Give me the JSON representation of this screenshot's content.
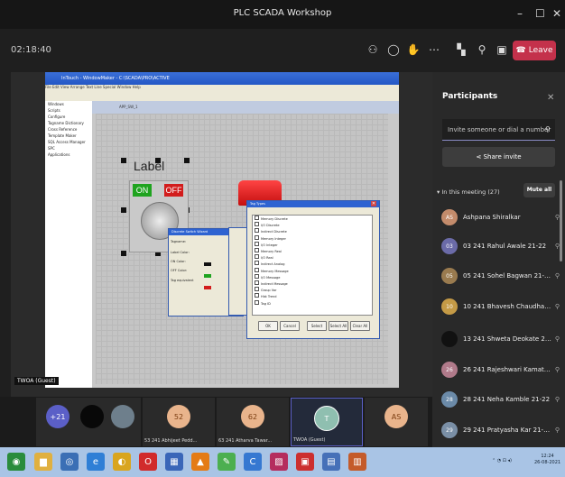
{
  "window": {
    "title": "PLC SCADA Workshop",
    "minimize": "–",
    "maximize": "☐",
    "close": "✕"
  },
  "meeting": {
    "timer": "02:18:40",
    "leave_label": "Leave",
    "icons": [
      "participants-icon",
      "chat-icon",
      "reactions-icon",
      "more-icon",
      "camera-off-icon",
      "mic-off-icon",
      "share-tray-icon"
    ]
  },
  "shared_screen": {
    "app_title": "InTouch - WindowMaker - C:\\SCADA\\PRO\\ACTIVE",
    "menu_text": "File  Edit  View  Arrange  Text  Line  Special  Window  Help",
    "tree_items": [
      "Windows",
      "Scripts",
      "Configure",
      "Tagname Dictionary",
      "Cross Reference",
      "Template Maker",
      "SQL Access Manager",
      "SPC",
      "Applications"
    ],
    "canvas_tab": "APP_SW_1",
    "switch_label": "Label",
    "on_label": "ON",
    "off_label": "OFF",
    "dialog1_title": "Discrete Switch Wizard",
    "dialog1_tagname_label": "Tagname:",
    "dialog1_fields": [
      "Label Color:",
      "ON Color:",
      "OFF Color:",
      "Switch Label:",
      "ON Label:",
      "OFF Label:"
    ],
    "dialog1_button": "Tag equivalent",
    "dialog3_title": "Tag Types",
    "tag_types": [
      "Memory Discrete",
      "I/O Discrete",
      "Indirect Discrete",
      "Memory Integer",
      "I/O Integer",
      "Memory Real",
      "I/O Real",
      "Indirect Analog",
      "Memory Message",
      "I/O Message",
      "Indirect Message",
      "Group Var",
      "Hist Trend",
      "Tag ID"
    ],
    "dialog_buttons": [
      "OK",
      "Cancel",
      "Select",
      "Select All",
      "Clear All"
    ],
    "speaker_tag": "TWOA (Guest)"
  },
  "participants_panel": {
    "title": "Participants",
    "invite_placeholder": "Invite someone or dial a number",
    "share_invite": "Share invite",
    "section_label": "In this meeting (27)",
    "mute_all": "Mute all",
    "people": [
      {
        "initials": "AS",
        "name": "Ashpana Shiralkar",
        "color": "#c38b6b"
      },
      {
        "initials": "03",
        "name": "03 241 Rahul Awale 21-22",
        "color": "#6b6ba8"
      },
      {
        "initials": "05",
        "name": "05 241 Sohel Bagwan 21-22",
        "color": "#9a7b4f"
      },
      {
        "initials": "10",
        "name": "10 241 Bhavesh Chaudhari 21...",
        "color": "#c49a46"
      },
      {
        "initials": "",
        "name": "13 241 Shweta Deokate 21-22",
        "color": "#111111"
      },
      {
        "initials": "26",
        "name": "26 241 Rajeshwari Kamat 21-22",
        "color": "#b07a8a"
      },
      {
        "initials": "28",
        "name": "28 241 Neha Kamble 21-22",
        "color": "#6b8aa8"
      },
      {
        "initials": "29",
        "name": "29 241 Pratyasha Kar 21-22",
        "color": "#7a8fa6"
      }
    ]
  },
  "tiles": [
    {
      "label": "+21",
      "caption": "",
      "color": "#5b5fc7"
    },
    {
      "label": "",
      "caption": "",
      "color": "#080808"
    },
    {
      "label": "",
      "caption": "",
      "color": "#6e7f8c"
    },
    {
      "label": "52",
      "caption": "53 241 Abhijeet Pedd...",
      "color": "#e9b48c"
    },
    {
      "label": "62",
      "caption": "63 241 Atharva Tawar...",
      "color": "#e9b48c"
    },
    {
      "label": "T",
      "caption": "TWOA (Guest)",
      "color": "#8fbfb0"
    },
    {
      "label": "AS",
      "caption": "",
      "color": "#e9b48c"
    }
  ],
  "taskbar": {
    "apps": [
      {
        "icon": "start-icon",
        "glyph": "◉",
        "color": "#2a8c3c"
      },
      {
        "icon": "folder-icon",
        "glyph": "▆",
        "color": "#e0b040"
      },
      {
        "icon": "search-icon",
        "glyph": "◎",
        "color": "#3b6fb5"
      },
      {
        "icon": "ie-icon",
        "glyph": "e",
        "color": "#2f7fd6"
      },
      {
        "icon": "chrome-icon",
        "glyph": "◐",
        "color": "#d9a51f"
      },
      {
        "icon": "opera-icon",
        "glyph": "O",
        "color": "#d12b2b"
      },
      {
        "icon": "photos-icon",
        "glyph": "▦",
        "color": "#3a66b8"
      },
      {
        "icon": "vlc-icon",
        "glyph": "▲",
        "color": "#e47b16"
      },
      {
        "icon": "paint-icon",
        "glyph": "✎",
        "color": "#4caf50"
      },
      {
        "icon": "teams-taskbar-icon",
        "glyph": "C",
        "color": "#3678d1"
      },
      {
        "icon": "app-icon",
        "glyph": "▨",
        "color": "#b52d5e"
      },
      {
        "icon": "pdf-icon",
        "glyph": "▣",
        "color": "#cc2f2f"
      },
      {
        "icon": "notes-icon",
        "glyph": "▤",
        "color": "#4670b8"
      },
      {
        "icon": "scada-icon",
        "glyph": "▥",
        "color": "#c45b2a"
      }
    ],
    "tray": "⌃ ◔ ⊡ ◂)",
    "time": "12:24",
    "date": "26-08-2021"
  }
}
